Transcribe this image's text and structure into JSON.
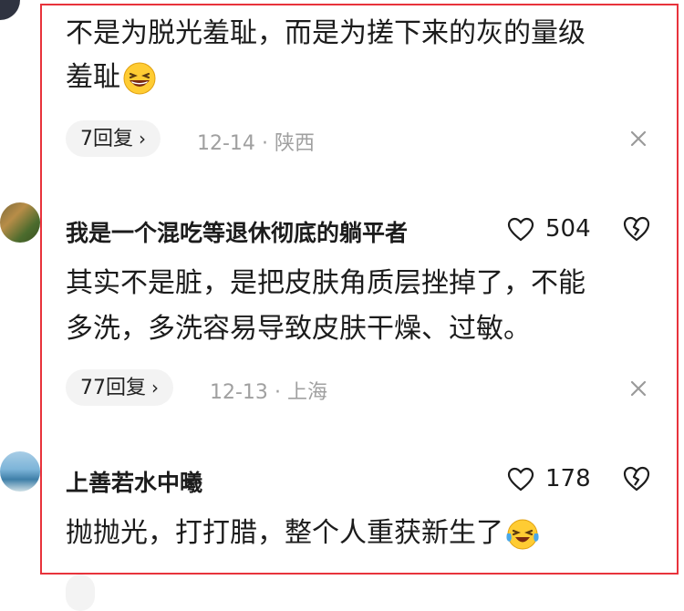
{
  "comments": [
    {
      "text_lines": [
        "不是为脱光羞耻，而是为搓下来的灰的量级",
        "羞耻"
      ],
      "reply_label": "7回复",
      "date": "12-14",
      "location": "陕西"
    },
    {
      "username": "我是一个混吃等退休彻底的躺平者",
      "likes": "504",
      "text_lines": [
        "其实不是脏，是把皮肤角质层挫掉了，不能",
        "多洗，多洗容易导致皮肤干燥、过敏。"
      ],
      "reply_label": "77回复",
      "date": "12-13",
      "location": "上海"
    },
    {
      "username": "上善若水中曦",
      "likes": "178",
      "text_lines": [
        "抛抛光，打打腊，整个人重获新生了"
      ]
    }
  ],
  "separator": "·",
  "colors": {
    "highlight_frame": "#e8333c",
    "meta_gray": "#a0a0a0",
    "pill_bg": "#f3f3f3"
  }
}
